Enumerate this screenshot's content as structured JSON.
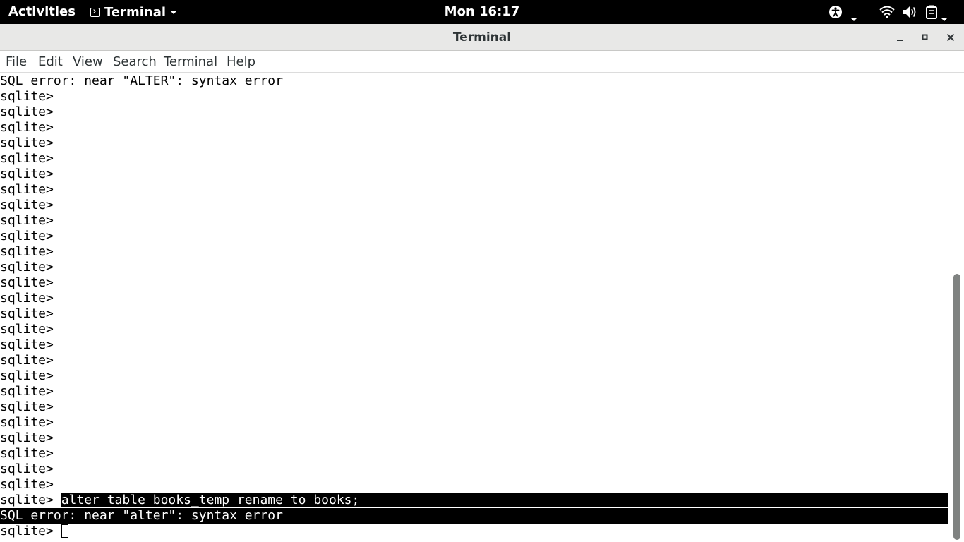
{
  "topbar": {
    "activities": "Activities",
    "app_name": "Terminal",
    "clock": "Mon 16:17",
    "icons": [
      "accessibility-icon",
      "wifi-icon",
      "volume-icon",
      "battery-icon"
    ]
  },
  "window": {
    "title": "Terminal",
    "buttons": [
      "minimize-icon",
      "maximize-icon",
      "close-icon"
    ]
  },
  "menubar": {
    "file": "File",
    "edit": "Edit",
    "view": "View",
    "search": "Search",
    "terminal": "Terminal",
    "help": "Help"
  },
  "terminal": {
    "first_line": "SQL error: near \"ALTER\": syntax error",
    "prompt": "sqlite> ",
    "empty_prompt_count": 26,
    "command_prompt": "sqlite> ",
    "command": "alter table books_temp rename to books;",
    "error_line": "SQL error: near \"alter\": syntax error",
    "last_prompt": "sqlite> "
  },
  "colors": {
    "topbar_bg": "#000000",
    "titlebar_bg": "#e8e8e7",
    "terminal_bg": "#ffffff",
    "terminal_fg": "#000000",
    "selection_bg": "#000000",
    "selection_fg": "#ffffff",
    "scroll_thumb": "#7f8281"
  }
}
